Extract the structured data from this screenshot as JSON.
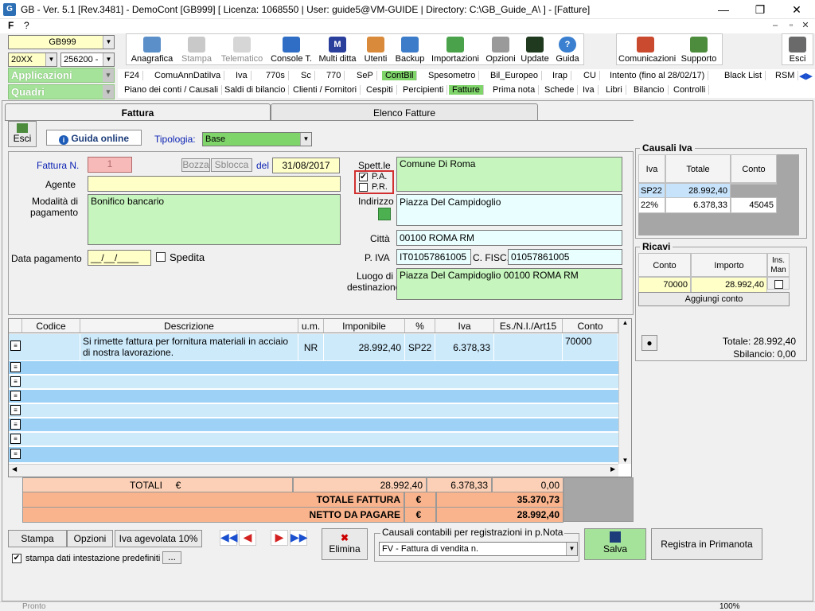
{
  "window": {
    "title": "GB - Ver. 5.1 [Rev.3481] -  DemoCont [GB999]    [ Licenza: 1068550 | User: guide5@VM-GUIDE | Directory: C:\\GB_Guide_A\\ ] - [Fatture]",
    "min": "—",
    "max": "❐",
    "close": "✕"
  },
  "menubar": {
    "f": "F",
    "q": "?"
  },
  "mdi": {
    "min": "–",
    "restore": "▫",
    "close": "✕"
  },
  "left": {
    "company": "GB999",
    "year": "20XX",
    "code": "256200 -",
    "applicazioni": "Applicazioni",
    "quadri": "Quadri"
  },
  "toolbar": {
    "anagrafica": "Anagrafica",
    "stampa": "Stampa",
    "telematico": "Telematico",
    "console": "Console T.",
    "multiditta": "Multi ditta",
    "utenti": "Utenti",
    "backup": "Backup",
    "importazioni": "Importazioni",
    "opzioni": "Opzioni",
    "update": "Update",
    "guida": "Guida",
    "comunicazioni": "Comunicazioni",
    "supporto": "Supporto",
    "esci": "Esci"
  },
  "tabs1": [
    "F24",
    "ComuAnnDatiIva",
    "Iva",
    "770s",
    "Sc",
    "770",
    "SeP",
    "ContBil",
    "Spesometro",
    "Bil_Europeo",
    "Irap",
    "CU",
    "Intento (fino al 28/02/17)",
    "Black List",
    "RSM"
  ],
  "tabs2": [
    "Piano dei conti / Causali",
    "Saldi di bilancio",
    "Clienti / Fornitori",
    "Cespiti",
    "Percipienti",
    "Fatture",
    "Prima nota",
    "Schede",
    "Iva",
    "Libri",
    "Bilancio",
    "Controlli"
  ],
  "subtabs": {
    "fattura": "Fattura",
    "elenco": "Elenco Fatture"
  },
  "form": {
    "esci": "Esci",
    "guida_online": "Guida online",
    "tipologia_label": "Tipologia:",
    "tipologia": "Base",
    "fattura_label": "Fattura N.",
    "fattura_n": "1",
    "bozza": "Bozza",
    "sblocca": "Sblocca",
    "del_label": "del",
    "data": "31/08/2017",
    "agente_label": "Agente",
    "agente": "",
    "modalita_label": "Modalità di pagamento",
    "modalita": "Bonifico bancario",
    "data_pag_label": "Data pagamento",
    "data_pag": "__/__/____",
    "spedita": "Spedita",
    "spett_label": "Spett.le",
    "spett": "Comune Di Roma",
    "pa": "P.A.",
    "pr": "P.R.",
    "indirizzo_label": "Indirizzo",
    "indirizzo": "Piazza Del Campidoglio",
    "citta_label": "Città",
    "citta": "00100  ROMA  RM",
    "piva_label": "P. IVA",
    "piva": "IT01057861005",
    "cf_label": "C. FISC.",
    "cf": "01057861005",
    "luogo_label": "Luogo di destinazione",
    "luogo": "Piazza Del Campidoglio 00100  ROMA  RM"
  },
  "grid": {
    "headers": [
      "Codice",
      "Descrizione",
      "u.m.",
      "Imponibile",
      "%",
      "Iva",
      "Es./N.I./Art15",
      "Conto"
    ],
    "row1": {
      "codice": "",
      "descrizione": "Si rimette fattura per fornitura materiali in acciaio di nostra lavorazione.",
      "um": "NR",
      "imponibile": "28.992,40",
      "perc": "SP22",
      "iva": "6.378,33",
      "es": "",
      "conto": "70000"
    }
  },
  "totals": {
    "totali_label": "TOTALI",
    "euro": "€",
    "imponibile": "28.992,40",
    "iva": "6.378,33",
    "es": "0,00",
    "tot_fattura_label": "TOTALE FATTURA",
    "tot_fattura": "35.370,73",
    "netto_label": "NETTO DA PAGARE",
    "netto": "28.992,40"
  },
  "causali_iva": {
    "title": "Causali Iva",
    "headers": [
      "Iva",
      "Totale",
      "Conto"
    ],
    "rows": [
      [
        "SP22",
        "28.992,40",
        ""
      ],
      [
        "22%",
        "6.378,33",
        "45045"
      ]
    ]
  },
  "ricavi": {
    "title": "Ricavi",
    "headers": [
      "Conto",
      "Importo",
      "Ins. Man"
    ],
    "row": [
      "70000",
      "28.992,40"
    ],
    "aggiungi": "Aggiungi conto",
    "totale": "Totale: 28.992,40",
    "sbilancio": "Sbilancio: 0,00"
  },
  "bottom": {
    "stampa": "Stampa",
    "opzioni": "Opzioni",
    "iva_agevolata": "Iva agevolata 10%",
    "elimina": "Elimina",
    "causali_label": "Causali contabili per registrazioni in p.Nota",
    "causale": "FV - Fattura di vendita n.",
    "salva": "Salva",
    "registra": "Registra in Primanota",
    "stampa_dati": "stampa dati intestazione predefiniti",
    "dots": "..."
  },
  "status": {
    "left": "Pronto",
    "zoom": "100%"
  }
}
